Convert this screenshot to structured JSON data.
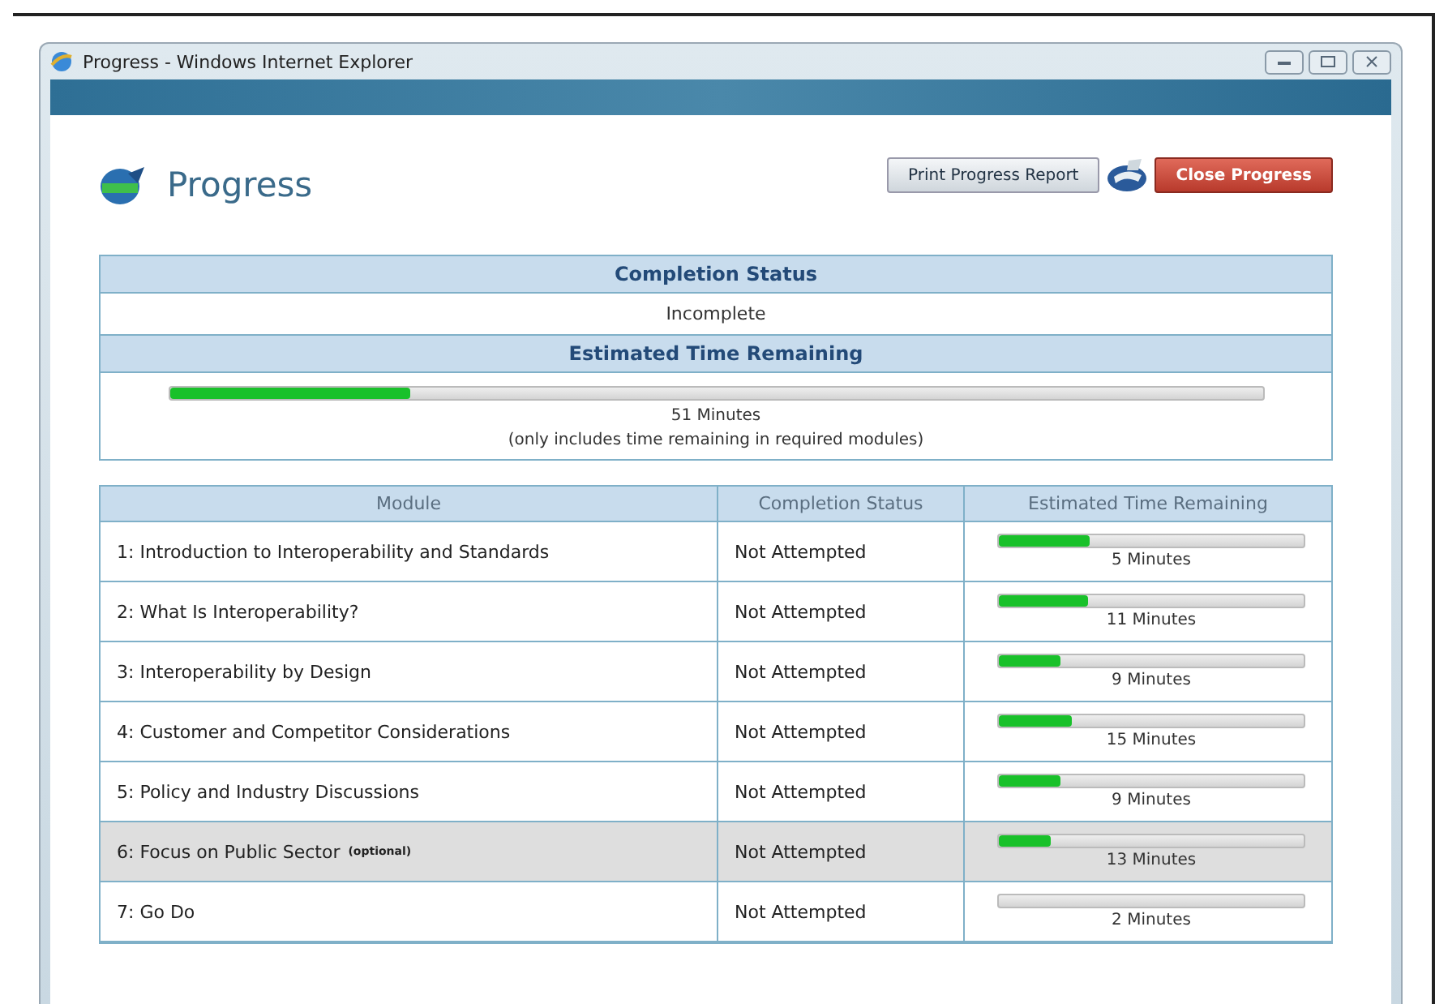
{
  "window": {
    "title": "Progress - Windows Internet Explorer"
  },
  "header": {
    "title": "Progress",
    "buttons": [
      {
        "label": "Print Progress Report",
        "kind": "plain"
      },
      {
        "label": "Close Progress",
        "kind": "danger"
      }
    ]
  },
  "summary": {
    "status_heading": "Completion Status",
    "status": "Incomplete",
    "time_heading": "Estimated Time Remaining",
    "level": 0.22,
    "time": "51 Minutes",
    "note": "(only includes time remaining in required modules)"
  },
  "table": {
    "columns": [
      "Module",
      "Completion Status",
      "Estimated Time Remaining"
    ],
    "rows": [
      {
        "module": "1: Introduction to Interoperability and Standards",
        "status": "Not Attempted",
        "level": 0.3,
        "time": "5 Minutes",
        "selected": false
      },
      {
        "module": "2: What Is Interoperability?",
        "status": "Not Attempted",
        "level": 0.29,
        "time": "11 Minutes",
        "selected": false
      },
      {
        "module": "3: Interoperability by Design",
        "status": "Not Attempted",
        "level": 0.2,
        "time": "9 Minutes",
        "selected": false
      },
      {
        "module": "4: Customer and Competitor Considerations",
        "status": "Not Attempted",
        "level": 0.24,
        "time": "15 Minutes",
        "selected": false
      },
      {
        "module": "5: Policy and Industry Discussions",
        "status": "Not Attempted",
        "level": 0.2,
        "time": "9 Minutes",
        "selected": false
      },
      {
        "module": "6: Focus on Public Sector",
        "tag": "(optional)",
        "status": "Not Attempted",
        "level": 0.17,
        "time": "13 Minutes",
        "selected": true
      },
      {
        "module": "7: Go Do",
        "status": "Not Attempted",
        "level": 0,
        "time": "2 Minutes",
        "selected": false
      }
    ]
  }
}
